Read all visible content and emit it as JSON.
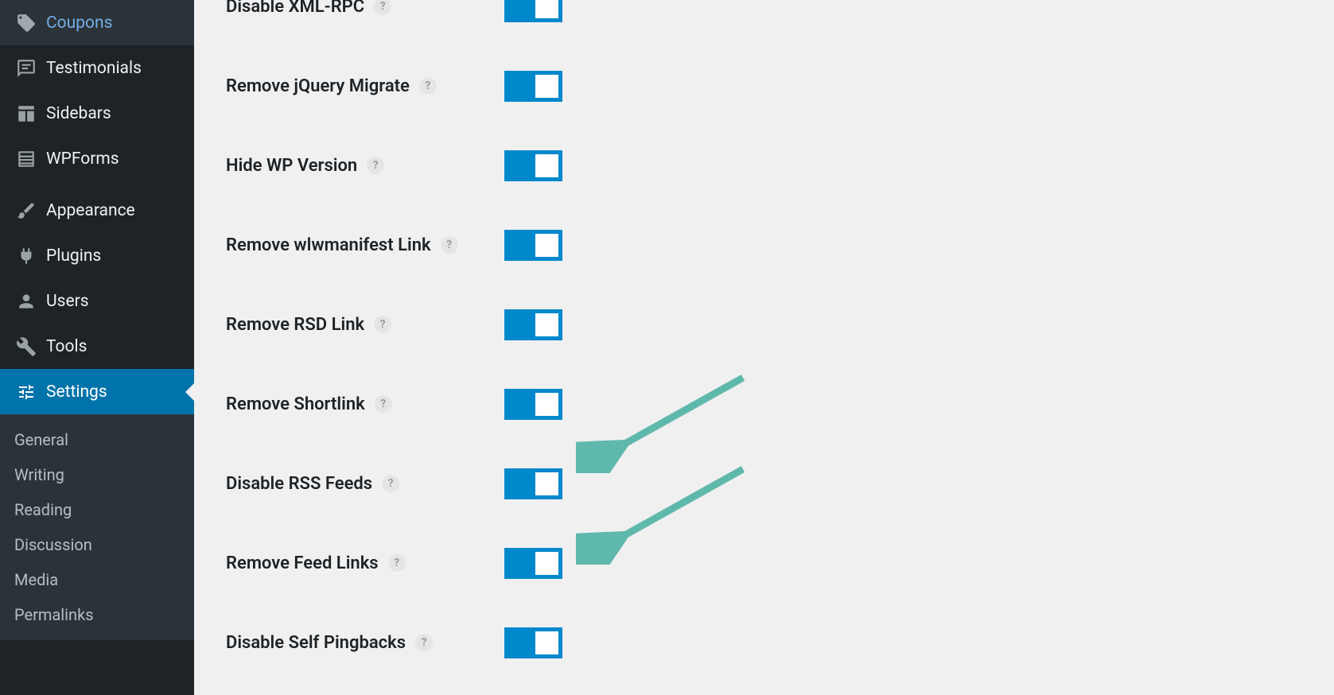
{
  "sidebar": {
    "items": [
      {
        "label": "Coupons",
        "icon": "tag"
      },
      {
        "label": "Testimonials",
        "icon": "testimonial"
      },
      {
        "label": "Sidebars",
        "icon": "layout"
      },
      {
        "label": "WPForms",
        "icon": "forms"
      }
    ],
    "admin_items": [
      {
        "label": "Appearance",
        "icon": "brush"
      },
      {
        "label": "Plugins",
        "icon": "plug"
      },
      {
        "label": "Users",
        "icon": "user"
      },
      {
        "label": "Tools",
        "icon": "wrench"
      },
      {
        "label": "Settings",
        "icon": "sliders",
        "current": true
      }
    ],
    "submenu": [
      {
        "label": "General"
      },
      {
        "label": "Writing"
      },
      {
        "label": "Reading"
      },
      {
        "label": "Discussion"
      },
      {
        "label": "Media"
      },
      {
        "label": "Permalinks"
      }
    ]
  },
  "settings": [
    {
      "label": "Disable XML-RPC",
      "on": true
    },
    {
      "label": "Remove jQuery Migrate",
      "on": true
    },
    {
      "label": "Hide WP Version",
      "on": true
    },
    {
      "label": "Remove wlwmanifest Link",
      "on": true
    },
    {
      "label": "Remove RSD Link",
      "on": true
    },
    {
      "label": "Remove Shortlink",
      "on": true
    },
    {
      "label": "Disable RSS Feeds",
      "on": true,
      "arrow": true
    },
    {
      "label": "Remove Feed Links",
      "on": true,
      "arrow": true
    },
    {
      "label": "Disable Self Pingbacks",
      "on": true
    }
  ],
  "colors": {
    "arrow": "#5fb8ac"
  }
}
